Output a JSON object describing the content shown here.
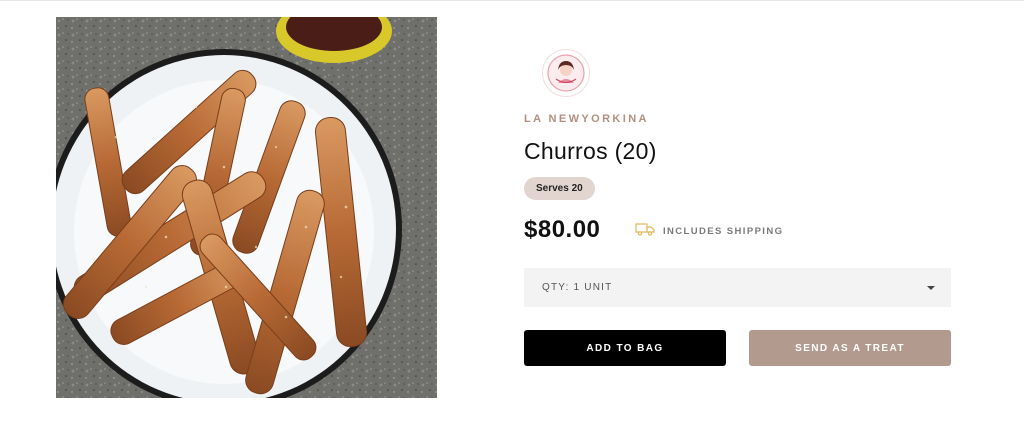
{
  "product": {
    "brand": "LA NEWYORKINA",
    "title": "Churros (20)",
    "serves_badge": "Serves 20",
    "price": "$80.00",
    "shipping_label": "INCLUDES SHIPPING"
  },
  "quantity_select": {
    "selected": "QTY: 1 UNIT"
  },
  "actions": {
    "add_to_bag": "ADD TO BAG",
    "send_as_treat": "SEND AS A TREAT"
  },
  "icons": {
    "shipping": "truck-icon",
    "dropdown": "chevron-down-icon",
    "brand_logo": "brand-logo"
  },
  "colors": {
    "brand_accent": "#b28f80",
    "badge_bg": "#e2d5d0",
    "primary_button": "#000000",
    "secondary_button": "#b39a8e",
    "select_bg": "#f3f3f3"
  }
}
